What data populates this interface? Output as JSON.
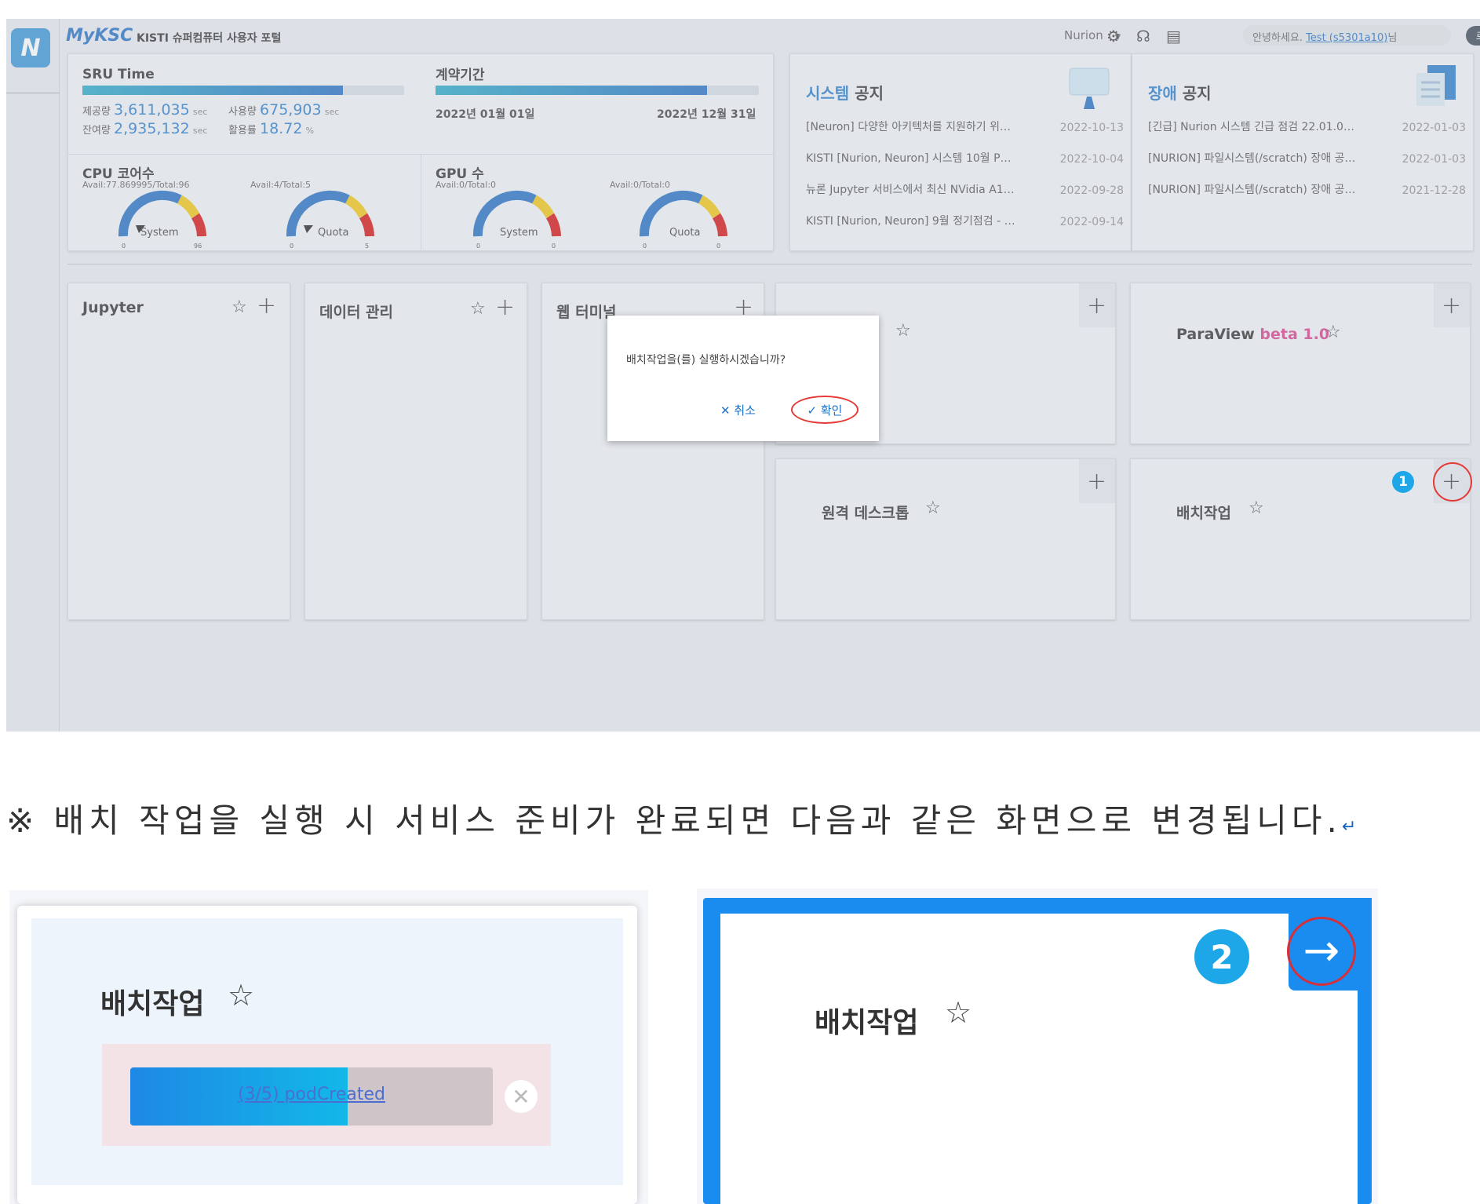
{
  "header": {
    "brand": "MyKSC",
    "brand_subtitle": "KISTI 슈퍼컴퓨터 사용자 포털",
    "system_select": "Nurion",
    "greeting_prefix": "안녕하세요.",
    "user_link": "Test (s5301a10)",
    "greeting_suffix": "님",
    "logout_label": "로그아웃"
  },
  "sru": {
    "title": "SRU Time",
    "usage_fraction": 0.81,
    "provided_label": "제공량",
    "provided_value": "3,611,035",
    "provided_unit": "sec",
    "used_label": "사용량",
    "used_value": "675,903",
    "used_unit": "sec",
    "remaining_label": "잔여량",
    "remaining_value": "2,935,132",
    "remaining_unit": "sec",
    "rate_label": "활용률",
    "rate_value": "18.72",
    "rate_unit": "%"
  },
  "contract": {
    "title": "계약기간",
    "progress_fraction": 0.84,
    "start": "2022년 01월 01일",
    "end": "2022년 12월 31일"
  },
  "cpu": {
    "title": "CPU 코어수",
    "system_avail": "Avail:77.869995/Total:96",
    "quota_avail": "Avail:4/Total:5",
    "system_label": "System",
    "system_min": "0",
    "system_max": "96",
    "quota_label": "Quota",
    "quota_min": "0",
    "quota_max": "5"
  },
  "gpu": {
    "title": "GPU 수",
    "system_avail": "Avail:0/Total:0",
    "quota_avail": "Avail:0/Total:0",
    "system_label": "System",
    "system_min": "0",
    "system_max": "0",
    "quota_label": "Quota",
    "quota_min": "0",
    "quota_max": "0"
  },
  "system_notice": {
    "title_highlight": "시스템",
    "title_rest": " 공지",
    "items": [
      {
        "title": "[Neuron] 다양한 아키텍처를 지원하기 위…",
        "date": "2022-10-13"
      },
      {
        "title": "KISTI [Nurion, Neuron] 시스템 10월 P…",
        "date": "2022-10-04"
      },
      {
        "title": "뉴론 Jupyter 서비스에서 최신 NVidia A1…",
        "date": "2022-09-28"
      },
      {
        "title": "KISTI [Nurion, Neuron] 9월 정기점검 - …",
        "date": "2022-09-14"
      }
    ]
  },
  "fault_notice": {
    "title_highlight": "장애",
    "title_rest": " 공지",
    "items": [
      {
        "title": "[긴급] Nurion 시스템 긴급 점검 22.01.0…",
        "date": "2022-01-03"
      },
      {
        "title": "[NURION] 파일시스템(/scratch) 장애 공…",
        "date": "2022-01-03"
      },
      {
        "title": "[NURION] 파일시스템(/scratch) 장애 공…",
        "date": "2021-12-28"
      }
    ]
  },
  "apps": {
    "jupyter": "Jupyter",
    "data": "데이터 관리",
    "web_terminal": "웹 터미널",
    "paraview": "ParaView",
    "paraview_beta": "beta 1.0",
    "remote_desktop": "원격 데스크톱",
    "batch": "배치작업"
  },
  "dialog": {
    "message": "배치작업을(를) 실행하시겠습니까?",
    "cancel_label": "✕ 취소",
    "confirm_label": "✓ 확인"
  },
  "badges": {
    "step1": "1",
    "step2": "2"
  },
  "note": {
    "text": "※ 배치 작업을 실행 시 서비스 준비가 완료되면 다음과 같은 화면으로 변경됩니다.",
    "return_mark": "↵"
  },
  "batch_pending": {
    "title": "배치작업",
    "progress_text": "(3/5) podCreated",
    "progress_fraction": 0.6
  },
  "batch_ready": {
    "title": "배치작업",
    "arrow": "→"
  },
  "colors": {
    "accent": "#1a73c8",
    "highlight_ring": "#e53935",
    "badge": "#1ea7e8",
    "ready_card": "#1a8cf0"
  }
}
